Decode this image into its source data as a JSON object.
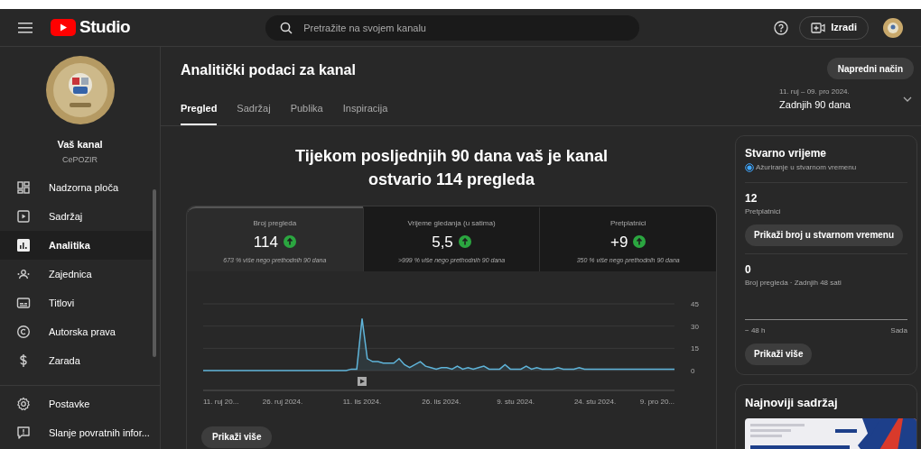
{
  "header": {
    "brand": "Studio",
    "search_placeholder": "Pretražite na svojem kanalu",
    "create_button": "Izradi"
  },
  "sidebar": {
    "channel_label": "Vaš kanal",
    "channel_name": "CePOZIR",
    "items": [
      {
        "label": "Nadzorna ploča",
        "selected": false
      },
      {
        "label": "Sadržaj",
        "selected": false
      },
      {
        "label": "Analitika",
        "selected": true
      },
      {
        "label": "Zajednica",
        "selected": false
      },
      {
        "label": "Titlovi",
        "selected": false
      },
      {
        "label": "Autorska prava",
        "selected": false
      },
      {
        "label": "Zarada",
        "selected": false
      }
    ],
    "footer_items": [
      {
        "label": "Postavke"
      },
      {
        "label": "Slanje povratnih infor..."
      }
    ]
  },
  "page": {
    "title": "Analitički podaci za kanal",
    "advanced_button": "Napredni način",
    "date_range": "11. ruj – 09. pro 2024.",
    "period": "Zadnjih 90 dana",
    "tabs": [
      {
        "label": "Pregled",
        "selected": true
      },
      {
        "label": "Sadržaj",
        "selected": false
      },
      {
        "label": "Publika",
        "selected": false
      },
      {
        "label": "Inspiracija",
        "selected": false
      }
    ]
  },
  "summary": "Tijekom posljednjih 90 dana vaš je kanal ostvario 114 pregleda",
  "metrics": [
    {
      "label": "Broj pregleda",
      "value": "114",
      "comparison": "673 % više nego prethodnih 90 dana",
      "selected": true
    },
    {
      "label": "Vrijeme gledanja (u satima)",
      "value": "5,5",
      "comparison": ">999 % više nego prethodnih 90 dana",
      "selected": false
    },
    {
      "label": "Pretplatnici",
      "value": "+9",
      "comparison": "350 % više nego prethodnih 90 dana",
      "selected": false
    }
  ],
  "chart_data": {
    "type": "area",
    "categories": [
      "11. ruj 20...",
      null,
      null,
      null,
      null,
      null,
      null,
      null,
      null,
      null,
      null,
      null,
      null,
      null,
      null,
      "26. ruj 2024.",
      null,
      null,
      null,
      null,
      null,
      null,
      null,
      null,
      null,
      null,
      null,
      null,
      null,
      null,
      "11. lis 2024.",
      null,
      null,
      null,
      null,
      null,
      null,
      null,
      null,
      null,
      null,
      null,
      null,
      null,
      null,
      "26. lis 2024.",
      null,
      null,
      null,
      null,
      null,
      null,
      null,
      null,
      null,
      null,
      null,
      null,
      null,
      "9. stu 2024.",
      null,
      null,
      null,
      null,
      null,
      null,
      null,
      null,
      null,
      null,
      null,
      null,
      null,
      null,
      "24. stu 2024.",
      null,
      null,
      null,
      null,
      null,
      null,
      null,
      null,
      null,
      null,
      null,
      null,
      null,
      null,
      "9. pro 20..."
    ],
    "series": [
      {
        "color": "#5fb4d9",
        "values": [
          0,
          0,
          0,
          0,
          0,
          0,
          0,
          0,
          0,
          0,
          0,
          0,
          0,
          0,
          0,
          0,
          0,
          0,
          0,
          0,
          0,
          0,
          0,
          0,
          0,
          0,
          0,
          0,
          1,
          1,
          35,
          8,
          6,
          6,
          5,
          5,
          5,
          8,
          4,
          2,
          4,
          6,
          3,
          2,
          1,
          2,
          2,
          1,
          3,
          1,
          2,
          1,
          2,
          3,
          1,
          1,
          1,
          4,
          1,
          1,
          1,
          3,
          1,
          2,
          1,
          1,
          1,
          2,
          1,
          1,
          1,
          2,
          1,
          1,
          1,
          1,
          1,
          1,
          1,
          1,
          1,
          1,
          1,
          1,
          1,
          1,
          1,
          1,
          1,
          1
        ]
      }
    ],
    "ylim": [
      0,
      45
    ],
    "yticks": [
      0,
      15,
      30,
      45
    ]
  },
  "show_more_button": "Prikaži više",
  "realtime": {
    "title": "Stvarno vrijeme",
    "live_label": "Ažuriranje u stvarnom vremenu",
    "subscribers": "12",
    "subscribers_label": "Pretplatnici",
    "realtime_button": "Prikaži broj u stvarnom vremenu",
    "views": "0",
    "views_label": "Broj pregleda · Zadnjih 48 sati",
    "axis_start": "− 48 h",
    "axis_end": "Sada",
    "more_button": "Prikaži više"
  },
  "latest": {
    "title": "Najnoviji sadržaj"
  }
}
